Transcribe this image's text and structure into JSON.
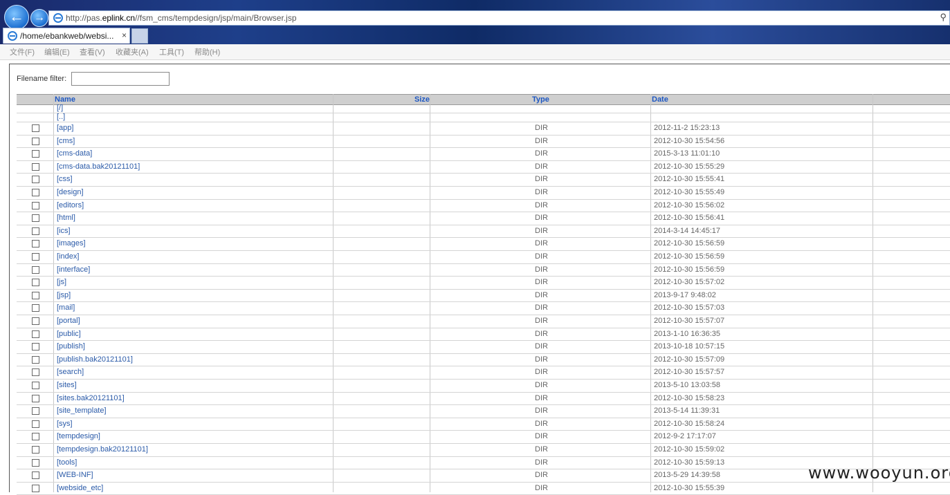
{
  "browser": {
    "url_prefix": "http://pas.",
    "url_domain": "eplink.cn",
    "url_path": "//fsm_cms/tempdesign/jsp/main/Browser.jsp",
    "tab_title": "/home/ebankweb/websi...",
    "tab_close": "×",
    "back_icon": "back-arrow-icon",
    "forward_icon": "forward-arrow-icon",
    "search_glyph": "⚲",
    "menu": [
      "文件(F)",
      "编辑(E)",
      "查看(V)",
      "收藏夹(A)",
      "工具(T)",
      "帮助(H)"
    ]
  },
  "page": {
    "filter_label": "Filename filter:",
    "filter_value": "",
    "columns": {
      "name": "Name",
      "size": "Size",
      "type": "Type",
      "date": "Date"
    },
    "up_links": [
      "[/]",
      "[..]"
    ],
    "rows": [
      {
        "name": "[app]",
        "type": "DIR",
        "date": "2012-11-2 15:23:13"
      },
      {
        "name": "[cms]",
        "type": "DIR",
        "date": "2012-10-30 15:54:56"
      },
      {
        "name": "[cms-data]",
        "type": "DIR",
        "date": "2015-3-13 11:01:10"
      },
      {
        "name": "[cms-data.bak20121101]",
        "type": "DIR",
        "date": "2012-10-30 15:55:29"
      },
      {
        "name": "[css]",
        "type": "DIR",
        "date": "2012-10-30 15:55:41"
      },
      {
        "name": "[design]",
        "type": "DIR",
        "date": "2012-10-30 15:55:49"
      },
      {
        "name": "[editors]",
        "type": "DIR",
        "date": "2012-10-30 15:56:02"
      },
      {
        "name": "[html]",
        "type": "DIR",
        "date": "2012-10-30 15:56:41"
      },
      {
        "name": "[ics]",
        "type": "DIR",
        "date": "2014-3-14 14:45:17"
      },
      {
        "name": "[images]",
        "type": "DIR",
        "date": "2012-10-30 15:56:59"
      },
      {
        "name": "[index]",
        "type": "DIR",
        "date": "2012-10-30 15:56:59"
      },
      {
        "name": "[interface]",
        "type": "DIR",
        "date": "2012-10-30 15:56:59"
      },
      {
        "name": "[js]",
        "type": "DIR",
        "date": "2012-10-30 15:57:02"
      },
      {
        "name": "[jsp]",
        "type": "DIR",
        "date": "2013-9-17 9:48:02"
      },
      {
        "name": "[mail]",
        "type": "DIR",
        "date": "2012-10-30 15:57:03"
      },
      {
        "name": "[portal]",
        "type": "DIR",
        "date": "2012-10-30 15:57:07"
      },
      {
        "name": "[public]",
        "type": "DIR",
        "date": "2013-1-10 16:36:35"
      },
      {
        "name": "[publish]",
        "type": "DIR",
        "date": "2013-10-18 10:57:15"
      },
      {
        "name": "[publish.bak20121101]",
        "type": "DIR",
        "date": "2012-10-30 15:57:09"
      },
      {
        "name": "[search]",
        "type": "DIR",
        "date": "2012-10-30 15:57:57"
      },
      {
        "name": "[sites]",
        "type": "DIR",
        "date": "2013-5-10 13:03:58"
      },
      {
        "name": "[sites.bak20121101]",
        "type": "DIR",
        "date": "2012-10-30 15:58:23"
      },
      {
        "name": "[site_template]",
        "type": "DIR",
        "date": "2013-5-14 11:39:31"
      },
      {
        "name": "[sys]",
        "type": "DIR",
        "date": "2012-10-30 15:58:24"
      },
      {
        "name": "[tempdesign]",
        "type": "DIR",
        "date": "2012-9-2 17:17:07"
      },
      {
        "name": "[tempdesign.bak20121101]",
        "type": "DIR",
        "date": "2012-10-30 15:59:02"
      },
      {
        "name": "[tools]",
        "type": "DIR",
        "date": "2012-10-30 15:59:13"
      },
      {
        "name": "[WEB-INF]",
        "type": "DIR",
        "date": "2013-5-29 14:39:58"
      },
      {
        "name": "[webside_etc]",
        "type": "DIR",
        "date": "2012-10-30 15:55:39"
      }
    ]
  },
  "watermark": "www.wooyun.org"
}
